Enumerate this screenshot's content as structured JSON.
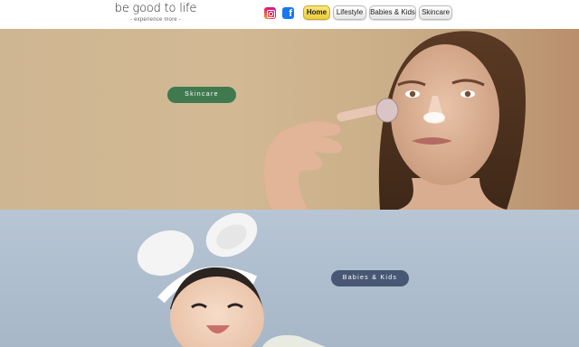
{
  "header": {
    "logo_title": "be good to life",
    "logo_subtitle": "- experience more -",
    "social": [
      {
        "name": "instagram-icon"
      },
      {
        "name": "facebook-icon",
        "glyph": "f"
      }
    ],
    "nav": [
      "Home",
      "Lifestyle",
      "Babies & Kids",
      "Skincare"
    ],
    "active_nav": "Home"
  },
  "sections": {
    "skincare": {
      "button_label": "Skincare",
      "button_color": "#3f7a4f"
    },
    "babies": {
      "button_label": "Babies & Kids",
      "button_color": "#485774"
    }
  },
  "colors": {
    "home_active": "#f1d54a",
    "skincare_bg": "#d2b994",
    "babies_bg": "#b0c0d0"
  }
}
